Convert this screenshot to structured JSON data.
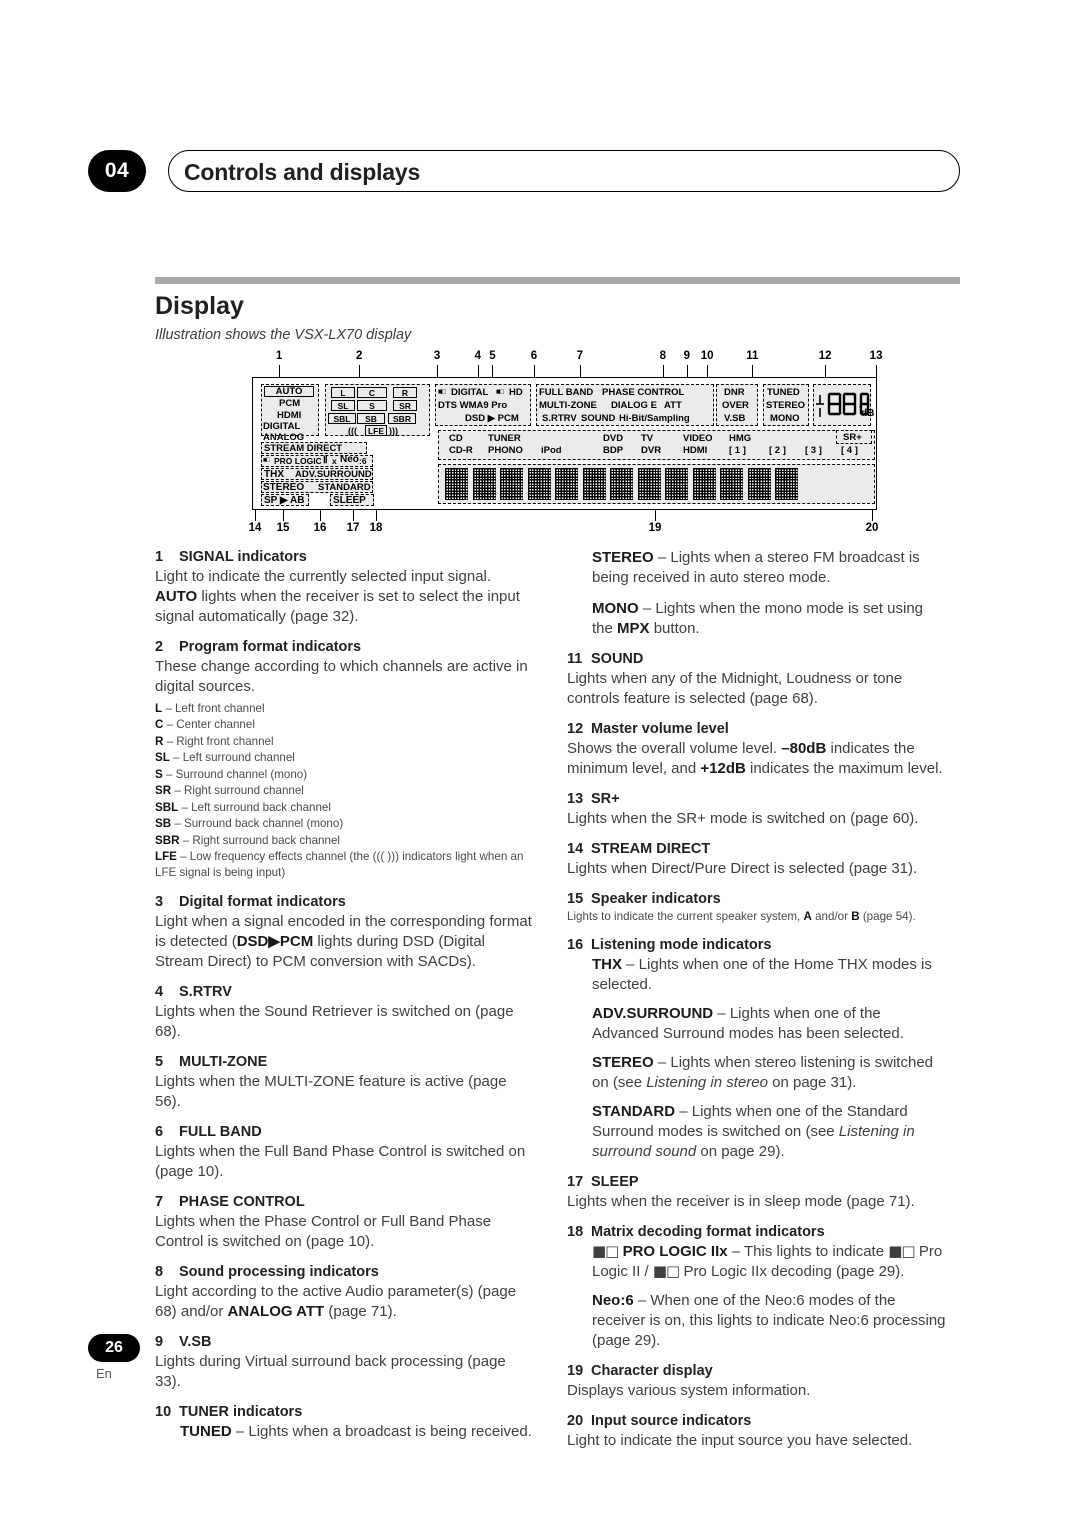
{
  "header": {
    "chapter_number": "04",
    "title": "Controls and displays"
  },
  "section": {
    "title": "Display",
    "caption": "Illustration shows the VSX-LX70 display"
  },
  "footer": {
    "page_number": "26",
    "language": "En"
  },
  "display_panel": {
    "callout_numbers_top": [
      "1",
      "2",
      "3",
      "4",
      "5",
      "6",
      "7",
      "8",
      "9",
      "10",
      "11",
      "12",
      "13"
    ],
    "callout_numbers_bottom": [
      "14",
      "15",
      "16",
      "17",
      "18",
      "19",
      "20"
    ],
    "signal_indicators": [
      "AUTO",
      "PCM",
      "HDMI",
      "DIGITAL",
      "ANALOG"
    ],
    "channel_indicators": [
      "L",
      "C",
      "R",
      "SL",
      "S",
      "SR",
      "SBL",
      "SB",
      "SBR"
    ],
    "lfe_label": "LFE",
    "lfe_left": "(((",
    "lfe_right": ")))",
    "digital_format": {
      "row1_a": "DIGITAL",
      "row1_b": "HD",
      "row2": "DTS    WMA9  Pro",
      "row3": "DSD ▶ PCM"
    },
    "phase_group": {
      "full_band": "FULL BAND",
      "phase_control": "PHASE CONTROL",
      "multi_zone": "MULTI-ZONE",
      "dialog_e": "DIALOG E",
      "att": "ATT",
      "s_rtrv": "S.RTRV",
      "sound": "SOUND",
      "hi_bit": "Hi-Bit/Sampling"
    },
    "dnr_group": [
      "DNR",
      "OVER",
      "V.SB"
    ],
    "tuner_group": [
      "TUNED",
      "STEREO",
      "MONO"
    ],
    "volume": {
      "digits": "88",
      "degree": "°",
      "unit": "dB"
    },
    "sr_plus": "SR+",
    "input_sources_row1": [
      "CD",
      "TUNER",
      "",
      "DVD",
      "TV",
      "VIDEO",
      "HMG",
      "",
      "",
      ""
    ],
    "input_sources_row2": [
      "CD-R",
      "PHONO",
      "iPod",
      "BDP",
      "DVR",
      "HDMI",
      "[ 1 ]",
      "[ 2 ]",
      "[ 3 ]",
      "[ 4 ]"
    ],
    "listening_modes": {
      "stream_direct": "STREAM DIRECT",
      "pro_logic": "PRO LOGIC",
      "pro_logic_ii": "Ⅱ",
      "pro_logic_x": "x",
      "neo": "Neo",
      "neo_6": ":6",
      "thx": "THX",
      "adv_surround": "ADV.SURROUND",
      "stereo": "STEREO",
      "standard": "STANDARD",
      "sp": "SP ▶ AB",
      "sleep": "SLEEP"
    }
  },
  "left_column": [
    {
      "num": "1",
      "head": "SIGNAL indicators",
      "body_parts": [
        {
          "t": "Light to indicate the currently selected input signal. "
        },
        {
          "t": "AUTO",
          "b": true
        },
        {
          "t": " lights when the receiver is set to select the input signal automatically (page 32)."
        }
      ]
    },
    {
      "num": "2",
      "head": "Program format indicators",
      "body_parts": [
        {
          "t": "These change according to which channels are active in digital sources."
        }
      ],
      "channel_list": [
        {
          "abbr": "L",
          "desc": " – Left front channel"
        },
        {
          "abbr": "C",
          "desc": " – Center channel"
        },
        {
          "abbr": "R",
          "desc": " – Right front channel"
        },
        {
          "abbr": "SL",
          "desc": " – Left surround channel"
        },
        {
          "abbr": "S",
          "desc": " – Surround channel (mono)"
        },
        {
          "abbr": "SR",
          "desc": " – Right surround channel"
        },
        {
          "abbr": "SBL",
          "desc": " – Left surround back channel"
        },
        {
          "abbr": "SB",
          "desc": " – Surround back channel (mono)"
        },
        {
          "abbr": "SBR",
          "desc": " – Right surround back channel"
        }
      ],
      "lfe_note": "LFE – Low frequency effects channel (the ((( ))) indicators light when an LFE signal is being input)"
    },
    {
      "num": "3",
      "head": "Digital format indicators",
      "body_parts": [
        {
          "t": "Light when a signal encoded in the corresponding format is detected ("
        },
        {
          "t": "DSD▶PCM",
          "b": true
        },
        {
          "t": " lights during DSD (Digital Stream Direct) to PCM conversion with SACDs)."
        }
      ]
    },
    {
      "num": "4",
      "head": "S.RTRV",
      "body_parts": [
        {
          "t": "Lights when the Sound Retriever is switched on (page 68)."
        }
      ]
    },
    {
      "num": "5",
      "head": "MULTI-ZONE",
      "body_parts": [
        {
          "t": "Lights when the MULTI-ZONE feature is active (page 56)."
        }
      ]
    },
    {
      "num": "6",
      "head": "FULL BAND",
      "body_parts": [
        {
          "t": "Lights when the Full Band Phase Control is switched on (page 10)."
        }
      ]
    },
    {
      "num": "7",
      "head": "PHASE CONTROL",
      "body_parts": [
        {
          "t": "Lights when the Phase Control or Full Band Phase Control is switched on (page 10)."
        }
      ]
    },
    {
      "num": "8",
      "head": "Sound processing indicators",
      "body_parts": [
        {
          "t": "Light according to the active Audio parameter(s) (page 68) and/or "
        },
        {
          "t": "ANALOG ATT",
          "b": true
        },
        {
          "t": " (page 71)."
        }
      ]
    },
    {
      "num": "9",
      "head": "V.SB",
      "body_parts": [
        {
          "t": "Lights during Virtual surround back processing (page 33)."
        }
      ]
    },
    {
      "num": "10",
      "head": "TUNER indicators",
      "indent_parts": [
        {
          "t": "TUNED",
          "b": true
        },
        {
          "t": " – Lights when a broadcast is being received."
        }
      ]
    }
  ],
  "right_column": [
    {
      "num": "",
      "head": "",
      "indent_parts": [
        {
          "t": "STEREO",
          "b": true
        },
        {
          "t": " – Lights when a stereo FM broadcast is being received in auto stereo mode."
        }
      ]
    },
    {
      "num": "",
      "head": "",
      "indent_parts": [
        {
          "t": "MONO",
          "b": true
        },
        {
          "t": " – Lights when the mono mode is set using the "
        },
        {
          "t": "MPX",
          "b": true
        },
        {
          "t": " button."
        }
      ]
    },
    {
      "num": "11",
      "head": "SOUND",
      "body_parts": [
        {
          "t": "Lights when any of the Midnight, Loudness or tone controls feature is selected (page 68)."
        }
      ]
    },
    {
      "num": "12",
      "head": "Master volume level",
      "body_parts": [
        {
          "t": "Shows the overall volume level. "
        },
        {
          "t": "–80dB",
          "b": true
        },
        {
          "t": " indicates the minimum level, and "
        },
        {
          "t": "+12dB",
          "b": true
        },
        {
          "t": " indicates the maximum level."
        }
      ]
    },
    {
      "num": "13",
      "head": "SR+",
      "body_parts": [
        {
          "t": "Lights when the SR+ mode is switched on (page 60)."
        }
      ]
    },
    {
      "num": "14",
      "head": "STREAM DIRECT",
      "body_parts": [
        {
          "t": "Lights when Direct/Pure Direct is selected (page 31)."
        }
      ]
    },
    {
      "num": "15",
      "head": "Speaker indicators",
      "small_parts": [
        {
          "t": "Lights to indicate the current speaker system, "
        },
        {
          "t": "A",
          "b": true
        },
        {
          "t": " and/or "
        },
        {
          "t": "B",
          "b": true
        },
        {
          "t": " (page 54)."
        }
      ]
    },
    {
      "num": "16",
      "head": "Listening mode indicators",
      "sub_items": [
        [
          {
            "t": "THX",
            "b": true
          },
          {
            "t": " – Lights when one of the Home THX modes is selected."
          }
        ],
        [
          {
            "t": "ADV.SURROUND",
            "b": true
          },
          {
            "t": " – Lights when one of the Advanced Surround modes has been selected."
          }
        ],
        [
          {
            "t": "STEREO",
            "b": true
          },
          {
            "t": " – Lights when stereo listening is switched on (see "
          },
          {
            "t": "Listening in stereo",
            "i": true
          },
          {
            "t": " on page 31)."
          }
        ],
        [
          {
            "t": "STANDARD",
            "b": true
          },
          {
            "t": " – Lights when one of the Standard Surround modes is switched on (see "
          },
          {
            "t": "Listening in surround sound",
            "i": true
          },
          {
            "t": " on page 29)."
          }
        ]
      ]
    },
    {
      "num": "17",
      "head": "SLEEP",
      "body_parts": [
        {
          "t": "Lights when the receiver is in sleep mode (page 71)."
        }
      ]
    },
    {
      "num": "18",
      "head": "Matrix decoding format indicators",
      "sub_items": [
        [
          {
            "t": "■□ ",
            "dd": true
          },
          {
            "t": "PRO LOGIC IIx",
            "b": true
          },
          {
            "t": " – This lights to indicate "
          },
          {
            "t": "■□ ",
            "dd": true
          },
          {
            "t": "Pro Logic II / "
          },
          {
            "t": "■□ ",
            "dd": true
          },
          {
            "t": "Pro Logic IIx decoding (page 29)."
          }
        ],
        [
          {
            "t": "Neo:6",
            "b": true
          },
          {
            "t": " – When one of the Neo:6 modes of the receiver is on, this lights to indicate Neo:6 processing (page 29)."
          }
        ]
      ]
    },
    {
      "num": "19",
      "head": "Character display",
      "body_parts": [
        {
          "t": "Displays various system information."
        }
      ]
    },
    {
      "num": "20",
      "head": "Input source indicators",
      "body_parts": [
        {
          "t": "Light to indicate the input source you have selected."
        }
      ]
    }
  ]
}
